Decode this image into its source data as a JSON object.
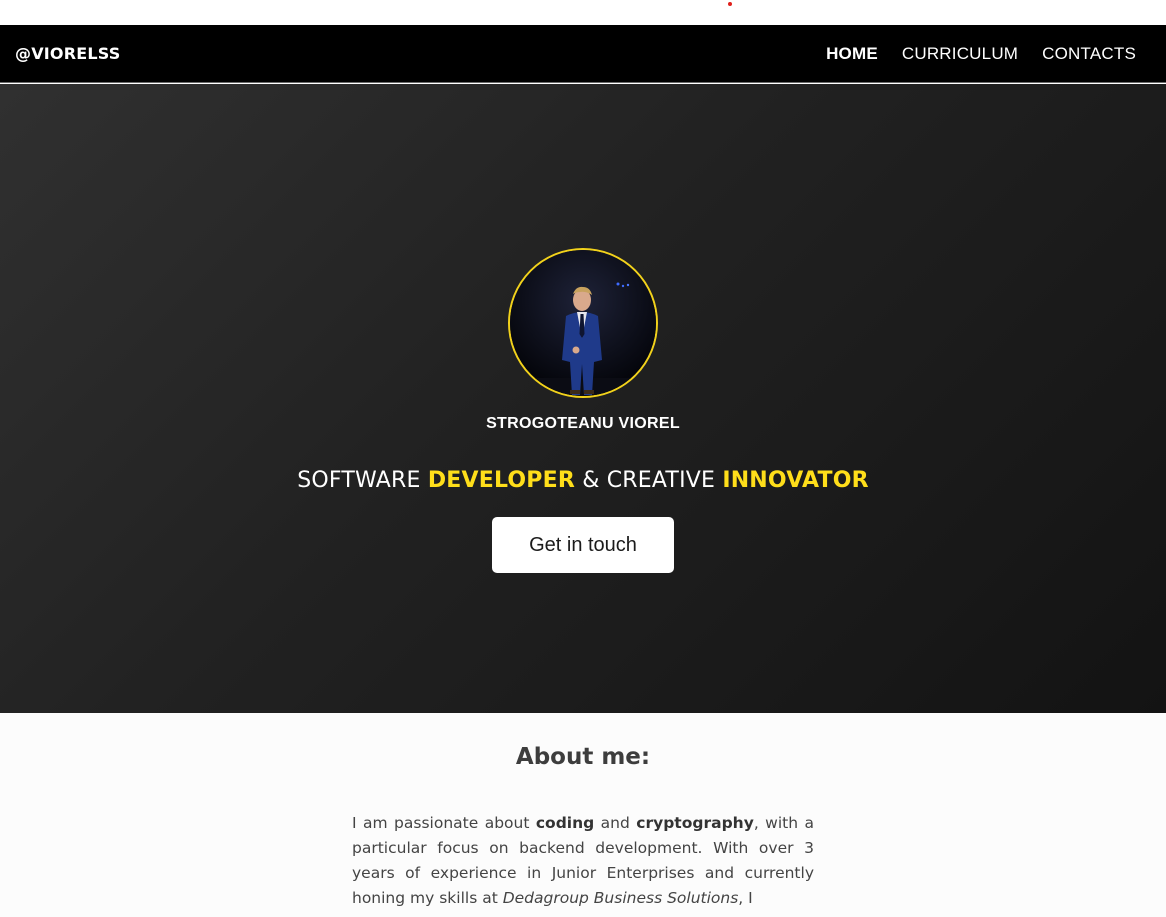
{
  "nav": {
    "brand": "@VIORELSS",
    "links": [
      "HOME",
      "CURRICULUM",
      "CONTACTS"
    ]
  },
  "hero": {
    "name": "STROGOTEANU VIOREL",
    "tagline": {
      "part1": "SOFTWARE ",
      "highlight1": "DEVELOPER",
      "part2": " & CREATIVE ",
      "highlight2": "INNOVATOR"
    },
    "cta_label": "Get in touch"
  },
  "about": {
    "title": "About me:",
    "text": {
      "t1": "I am passionate about ",
      "b1": "coding",
      "t2": " and ",
      "b2": "cryptography",
      "t3": ", with a particular focus on backend development. With over 3 years of experience in Junior Enterprises and currently honing my skills at ",
      "i1": "Dedagroup Business Solutions",
      "t4": ", I"
    }
  },
  "colors": {
    "accent": "#ffde1a",
    "avatar_border": "#f2d21b",
    "nav_bg": "#000000",
    "hero_bg": "#212121"
  },
  "icons": {
    "avatar": "profile-photo"
  }
}
